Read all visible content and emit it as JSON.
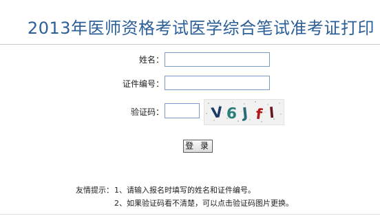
{
  "header": {
    "title": "2013年医师资格考试医学综合笔试准考证打印"
  },
  "form": {
    "name_label": "姓名：",
    "name_value": "",
    "id_label": "证件编号：",
    "id_value": "",
    "captcha_label": "验证码：",
    "captcha_value": "",
    "captcha_text": [
      "V",
      "6",
      "J",
      "f",
      "l"
    ],
    "login_label": "登 录"
  },
  "tips": {
    "prefix": "友情提示：",
    "line1": "1、请输入报名时填写的姓名和证件编号。",
    "line2": "2、如果验证码看不清楚，可以点击验证码图片更换。"
  },
  "colors": {
    "title": "#2b5f98",
    "input_border": "#7a9cc4",
    "captcha_v": "#1e3a66",
    "captcha_6": "#2a7f7a",
    "captcha_j": "#2b6b78",
    "captcha_f": "#b01818",
    "captcha_l": "#6a1420"
  }
}
